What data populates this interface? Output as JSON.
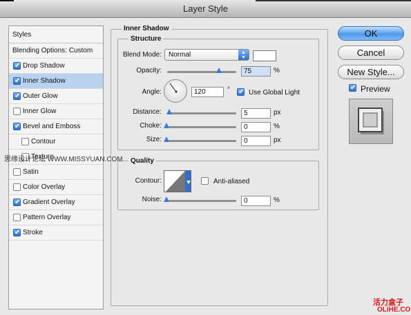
{
  "window": {
    "title": "Layer Style"
  },
  "styles_panel": {
    "header": "Styles",
    "blending_options": "Blending Options: Custom",
    "items": [
      {
        "label": "Drop Shadow",
        "checked": true,
        "selected": false,
        "sub": false
      },
      {
        "label": "Inner Shadow",
        "checked": true,
        "selected": true,
        "sub": false
      },
      {
        "label": "Outer Glow",
        "checked": true,
        "selected": false,
        "sub": false
      },
      {
        "label": "Inner Glow",
        "checked": false,
        "selected": false,
        "sub": false
      },
      {
        "label": "Bevel and Emboss",
        "checked": true,
        "selected": false,
        "sub": false
      },
      {
        "label": "Contour",
        "checked": false,
        "selected": false,
        "sub": true
      },
      {
        "label": "Texture",
        "checked": false,
        "selected": false,
        "sub": true
      },
      {
        "label": "Satin",
        "checked": false,
        "selected": false,
        "sub": false
      },
      {
        "label": "Color Overlay",
        "checked": false,
        "selected": false,
        "sub": false
      },
      {
        "label": "Gradient Overlay",
        "checked": true,
        "selected": false,
        "sub": false
      },
      {
        "label": "Pattern Overlay",
        "checked": false,
        "selected": false,
        "sub": false
      },
      {
        "label": "Stroke",
        "checked": true,
        "selected": false,
        "sub": false
      }
    ]
  },
  "inner_shadow": {
    "section_title": "Inner Shadow",
    "structure": {
      "title": "Structure",
      "blend_mode_label": "Blend Mode:",
      "blend_mode_value": "Normal",
      "opacity_label": "Opacity:",
      "opacity_value": "75",
      "opacity_unit": "%",
      "opacity_level": 0.75,
      "angle_label": "Angle:",
      "angle_value": "120",
      "angle_unit": "°",
      "use_global_light_label": "Use Global Light",
      "use_global_light_checked": true,
      "distance_label": "Distance:",
      "distance_value": "5",
      "distance_unit": "px",
      "choke_label": "Choke:",
      "choke_value": "0",
      "choke_unit": "%",
      "size_label": "Size:",
      "size_value": "0",
      "size_unit": "px"
    },
    "quality": {
      "title": "Quality",
      "contour_label": "Contour:",
      "anti_aliased_label": "Anti-aliased",
      "anti_aliased_checked": false,
      "noise_label": "Noise:",
      "noise_value": "0",
      "noise_unit": "%"
    }
  },
  "buttons": {
    "ok": "OK",
    "cancel": "Cancel",
    "new_style": "New Style...",
    "preview_label": "Preview",
    "preview_checked": true
  },
  "watermarks": {
    "left": "思缘设计论坛 WWW.MISSYUAN.COM",
    "right_top": "活力盒子",
    "right_bottom": "OLiHE.COM"
  },
  "colors": {
    "accent_blue": "#3a7bd8",
    "selected_row": "#b9d2f0",
    "watermark_red": "#d8181a"
  }
}
